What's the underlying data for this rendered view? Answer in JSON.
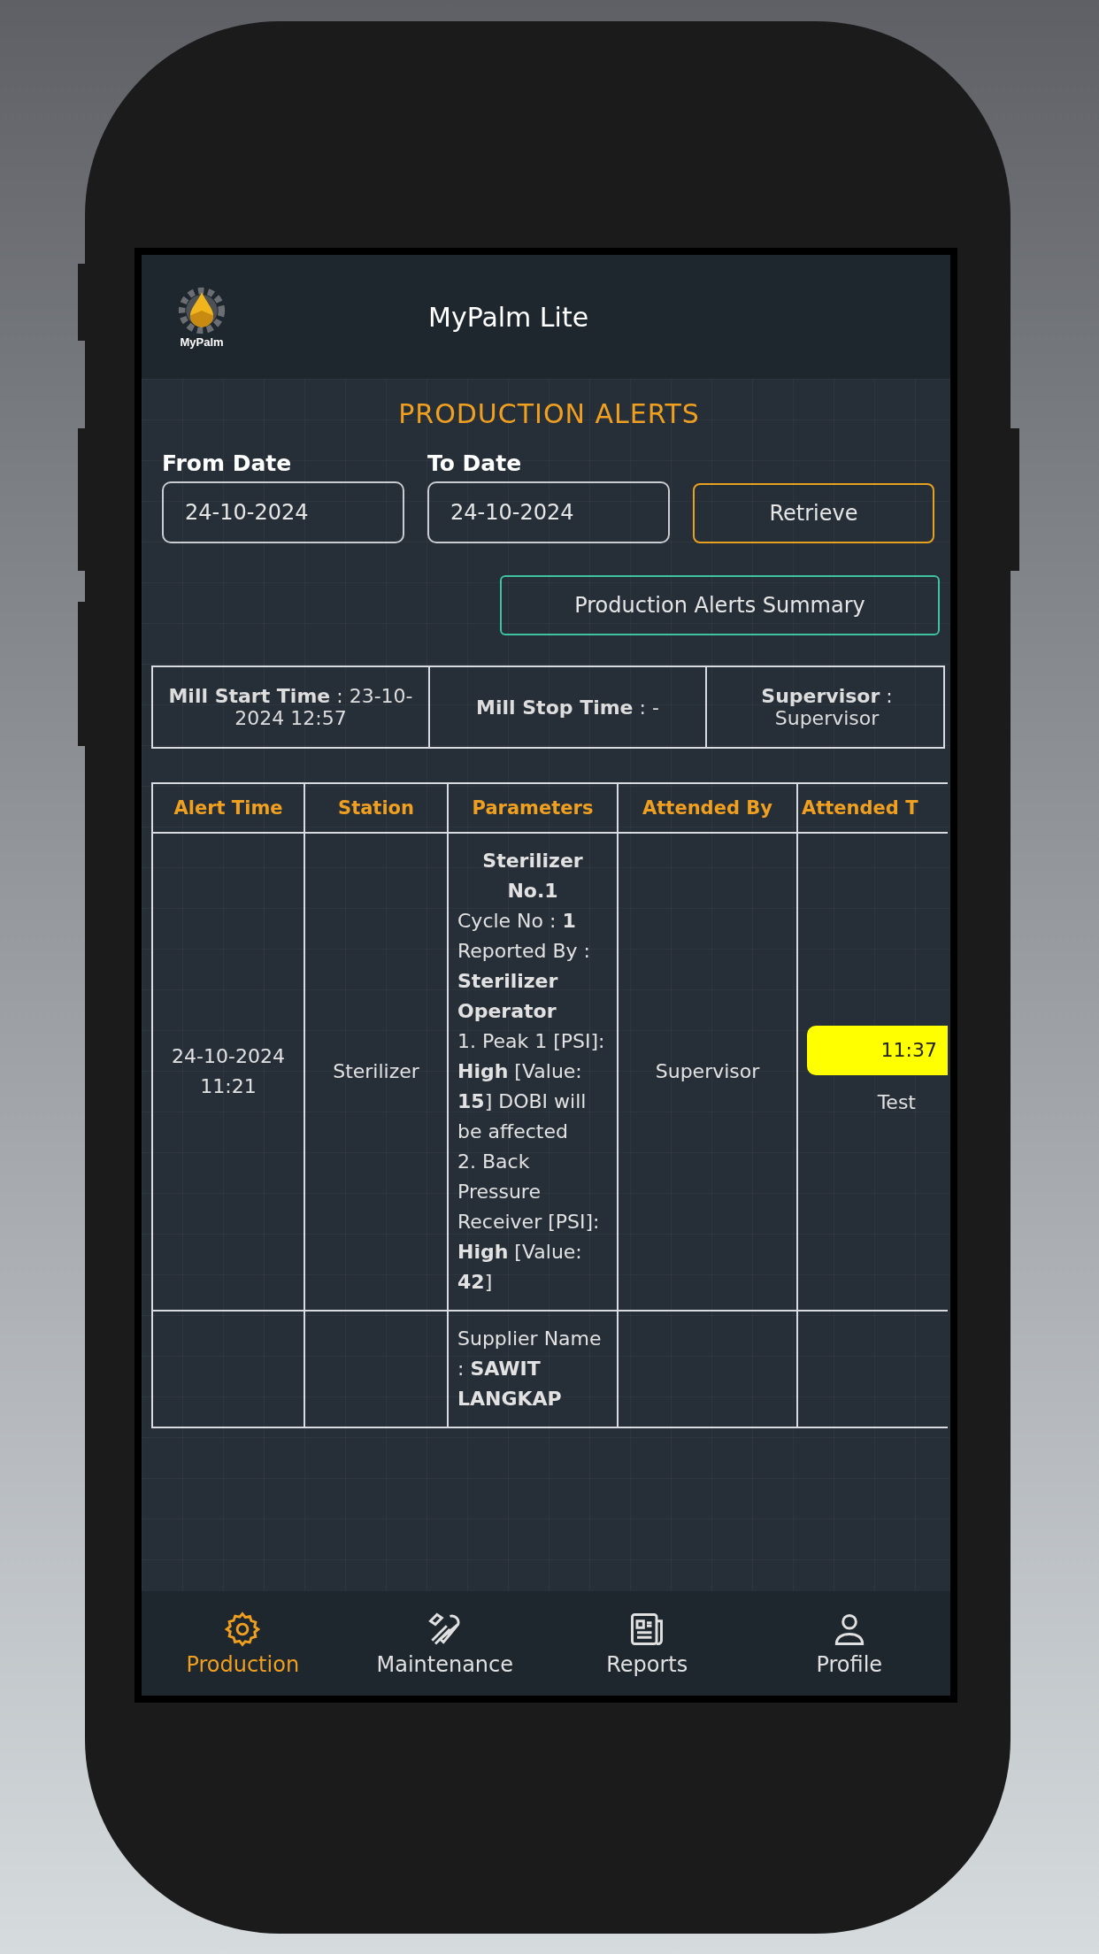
{
  "app_bar": {
    "logo_text": "MyPalm",
    "title": "MyPalm Lite"
  },
  "page_title": "PRODUCTION ALERTS",
  "filters": {
    "from_date": {
      "label": "From Date",
      "value": "24-10-2024"
    },
    "to_date": {
      "label": "To Date",
      "value": "24-10-2024"
    },
    "retrieve_button": "Retrieve",
    "summary_button": "Production Alerts Summary"
  },
  "mill_info": [
    "**Mill Start Time** : 23-10-2024 12:57",
    "**Mill Stop Time** : -",
    "**Supervisor** : Supervisor"
  ],
  "table": {
    "columns": [
      "Alert Time",
      "Station",
      "Parameters",
      "Attended By",
      "Attended T"
    ],
    "rows": [
      {
        "alert_time": "24-10-2024 11:21",
        "station": "Sterilizer",
        "parameters_title": "Sterilizer No.1",
        "parameters": [
          "Cycle No : **1**",
          "Reported By : **Sterilizer Operator**",
          "1. Peak 1 [PSI]: **High** [Value: **15**] DOBI will be affected",
          "2. Back Pressure Receiver [PSI]: **High** [Value: **42**]"
        ],
        "attended_by": "Supervisor",
        "attended_time": "11:37",
        "attended_note": "Test"
      },
      {
        "parameters": [
          "Supplier Name : **SAWIT LANGKAP**"
        ]
      }
    ]
  },
  "bottom_nav": [
    {
      "label": "Production",
      "selected": true
    },
    {
      "label": "Maintenance",
      "selected": false
    },
    {
      "label": "Reports",
      "selected": false
    },
    {
      "label": "Profile",
      "selected": false
    }
  ]
}
